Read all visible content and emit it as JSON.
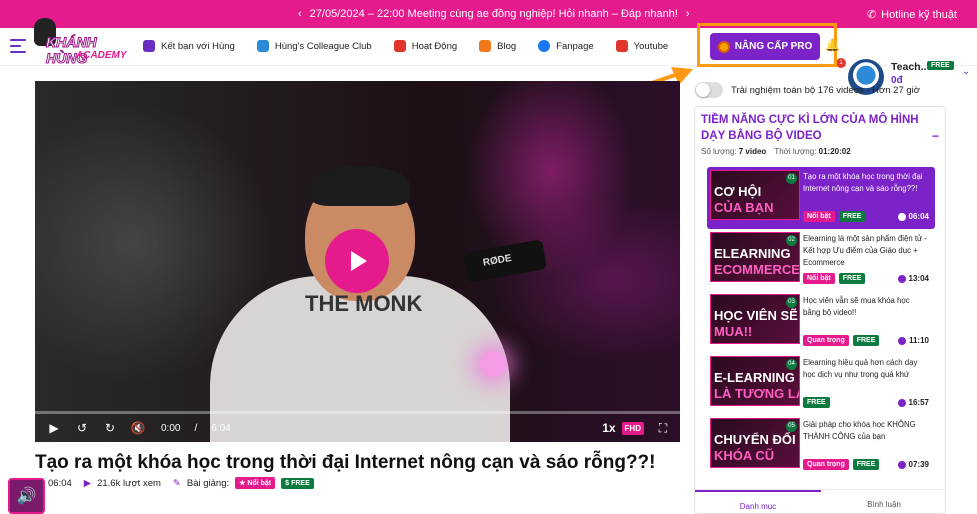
{
  "announcement": {
    "text": "27/05/2024 – 22:00 Meeting cùng ae đồng nghiệp! Hỏi nhanh – Đáp nhanh!"
  },
  "hotline": {
    "label": "Hotline kỹ thuật"
  },
  "brand": {
    "name": "KHÁNH HÙNG",
    "sub": "ACADEMY"
  },
  "nav": {
    "links": [
      {
        "label": "Kết bạn với Hùng",
        "color": "#6a2fc2"
      },
      {
        "label": "Hùng's Colleague Club",
        "color": "#2d8ad6"
      },
      {
        "label": "Hoạt Động",
        "color": "#e0362c"
      },
      {
        "label": "Blog",
        "color": "#f07a1a"
      },
      {
        "label": "Fanpage",
        "color": "#1877f2"
      },
      {
        "label": "Youtube",
        "color": "#e0362c"
      }
    ],
    "upgrade_label": "NÂNG CẤP PRO",
    "notification_count": "1",
    "user_name": "Teach..",
    "user_plan": "FREE",
    "credit": "0đ"
  },
  "trial": {
    "label": "Trải nghiệm toàn bộ 176 videos - Hơn 27 giờ"
  },
  "player": {
    "current_time": "0:00",
    "separator": "/",
    "duration": "6:04",
    "speed": "1x",
    "quality": "FHD",
    "shirt_text": "THE MONK",
    "mic_brand": "RØDE"
  },
  "video": {
    "title": "Tạo ra một khóa học trong thời đại Internet nông cạn và sáo rỗng??!",
    "length": "06:04",
    "views": "21.6k lượt xem",
    "lesson_label": "Bài giảng:",
    "tag_featured": "Nổi bật",
    "tag_free": "FREE"
  },
  "course": {
    "title": "TIỀM NĂNG CỰC KÌ LỚN CỦA MÔ HÌNH DẠY BẰNG BỘ VIDEO",
    "count_label": "Số lượng:",
    "count_value": "7 video",
    "duration_label": "Thời lượng:",
    "duration_value": "01:20:02",
    "lessons": [
      {
        "num": "01",
        "thumb1": "CƠ HỘI",
        "thumb2": "CỦA BẠN",
        "title": "Tạo ra một khóa học trong thời đại Internet nông cạn và sáo rỗng??!",
        "tag": "Nổi bật",
        "free": "FREE",
        "duration": "06:04"
      },
      {
        "num": "02",
        "thumb1": "ELEARNING",
        "thumb2": "ECOMMERCE",
        "title": "Elearning là một sản phẩm điện tử - Kết hợp Ưu điểm của Giáo dục + Ecommerce",
        "tag": "Nổi bật",
        "free": "FREE",
        "duration": "13:04"
      },
      {
        "num": "03",
        "thumb1": "HỌC VIÊN SẼ",
        "thumb2": "MUA!!",
        "title": "Học viên vẫn sẽ mua khóa học bằng bộ video!!",
        "tag": "Quan trọng",
        "free": "FREE",
        "duration": "11:10"
      },
      {
        "num": "04",
        "thumb1": "E-LEARNING",
        "thumb2": "LÀ TƯƠNG LAI",
        "title": "Elearning hiệu quả hơn cách dạy học dịch vụ như trong quá khứ",
        "tag": "",
        "free": "FREE",
        "duration": "16:57"
      },
      {
        "num": "05",
        "thumb1": "CHUYỂN ĐỔI",
        "thumb2": "KHÓA CŨ",
        "title": "Giải pháp cho khóa học KHÔNG THÀNH CÔNG của bạn",
        "tag": "Quan trọng",
        "free": "FREE",
        "duration": "07:39"
      }
    ],
    "tab_list": "Danh mục",
    "tab_comments": "Bình luận"
  },
  "colors": {
    "brand_pink": "#e51b8d",
    "brand_purple": "#7b22c9",
    "highlight_orange": "#ff9a12"
  }
}
